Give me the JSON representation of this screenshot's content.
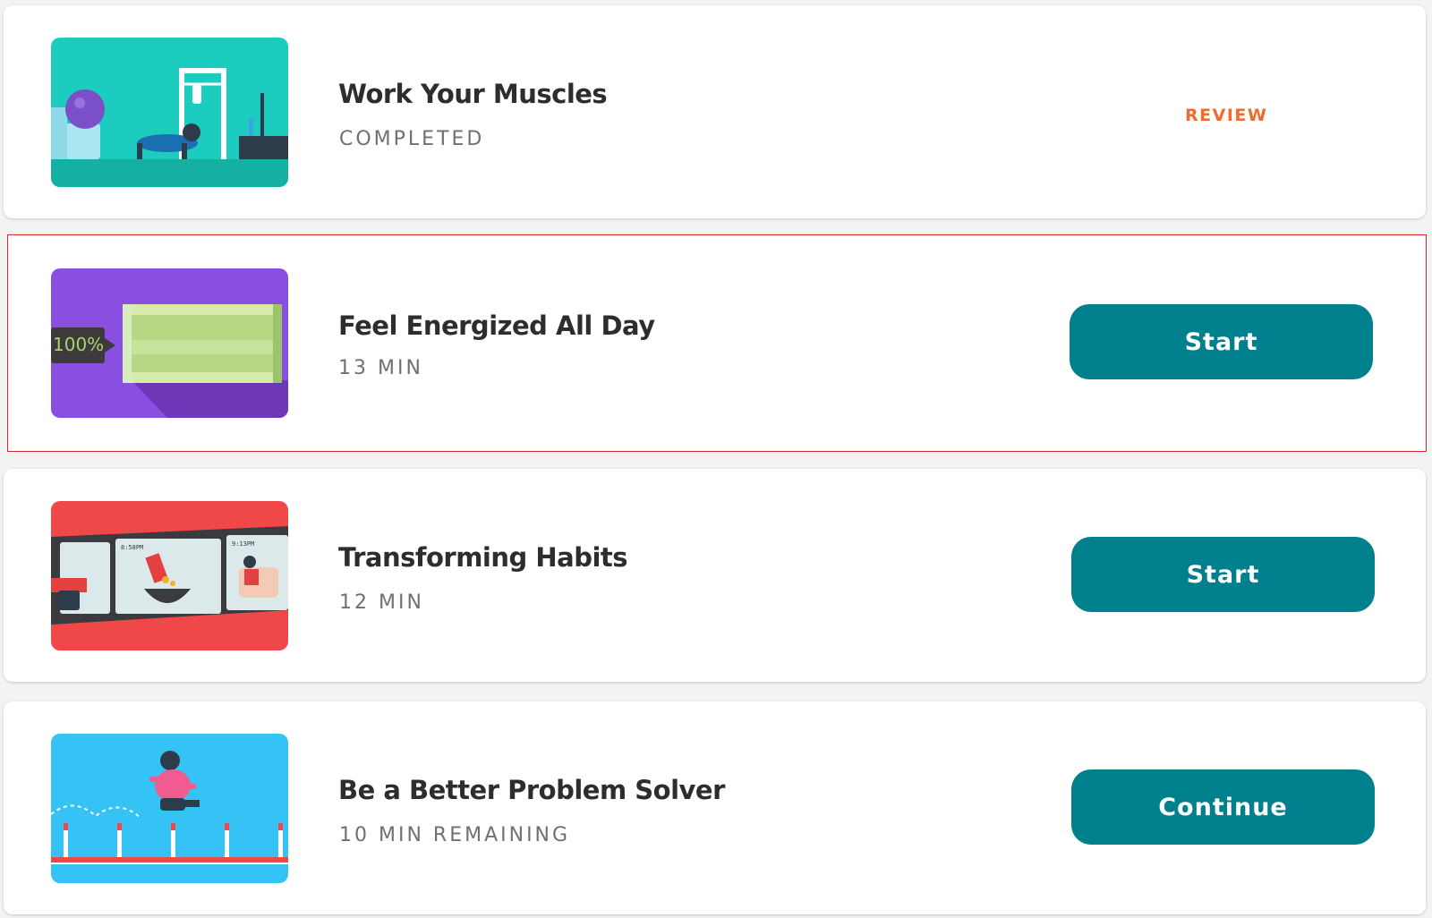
{
  "colors": {
    "page_background": "#f3f3f4",
    "card_background": "#ffffff",
    "title_text": "#2d2d2f",
    "subtitle_text": "#6f6f78",
    "review_orange": "#f26b2a",
    "button_teal": "#007f8c",
    "highlight_outline": "#e0262c"
  },
  "lessons": [
    {
      "title": "Work Your Muscles",
      "subtitle": "COMPLETED",
      "action_label": "REVIEW",
      "action_style": "link",
      "thumbnail": "workout-room-illustration"
    },
    {
      "title": "Feel Energized All Day",
      "subtitle": "13 MIN",
      "action_label": "Start",
      "action_style": "button",
      "thumbnail": "battery-illustration",
      "thumbnail_text": "100%",
      "highlighted": true
    },
    {
      "title": "Transforming Habits",
      "subtitle": "12 MIN",
      "action_label": "Start",
      "action_style": "button",
      "thumbnail": "film-strip-illustration",
      "thumbnail_text_1": "8:58PM",
      "thumbnail_text_2": "9:13PM"
    },
    {
      "title": "Be a Better Problem Solver",
      "subtitle": "10 MIN REMAINING",
      "action_label": "Continue",
      "action_style": "button",
      "thumbnail": "hurdle-jump-illustration"
    }
  ]
}
